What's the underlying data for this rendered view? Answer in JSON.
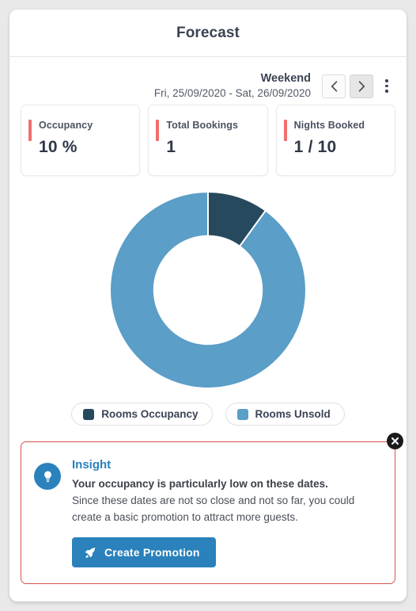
{
  "header": {
    "title": "Forecast"
  },
  "date_nav": {
    "kind": "Weekend",
    "range": "Fri, 25/09/2020 - Sat, 26/09/2020",
    "prev_icon": "chevron-left-icon",
    "next_icon": "chevron-right-icon",
    "menu_icon": "kebab-menu-icon"
  },
  "stats": [
    {
      "label": "Occupancy",
      "value": "10 %",
      "accent": "#ef6e6e"
    },
    {
      "label": "Total Bookings",
      "value": "1",
      "accent": "#ef6e6e"
    },
    {
      "label": "Nights Booked",
      "value": "1 / 10",
      "accent": "#ef6e6e"
    }
  ],
  "chart_data": {
    "type": "pie",
    "variant": "donut",
    "title": "",
    "categories": [
      "Rooms Occupancy",
      "Rooms Unsold"
    ],
    "values": [
      10,
      90
    ],
    "unit": "%",
    "colors": [
      "#27495e",
      "#5b9ec7"
    ],
    "start_angle": 0,
    "inner_radius_ratio": 0.55,
    "legend_position": "bottom",
    "grid": false
  },
  "legend": [
    {
      "label": "Rooms Occupancy",
      "color": "#27495e"
    },
    {
      "label": "Rooms Unsold",
      "color": "#5b9ec7"
    }
  ],
  "insight": {
    "bulb_icon": "lightbulb-icon",
    "title": "Insight",
    "headline": "Your occupancy is particularly low on these dates.",
    "description": "Since these dates are not so close and not so far, you could create a basic promotion to attract more guests.",
    "button_label": "Create Promotion",
    "button_icon": "rocket-icon",
    "close_icon": "close-icon",
    "border_color": "#d9534f",
    "accent_color": "#2a81bb"
  }
}
